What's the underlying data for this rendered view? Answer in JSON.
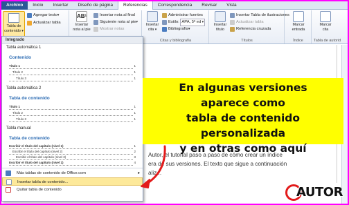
{
  "tabs": [
    "Archivo",
    "Inicio",
    "Insertar",
    "Diseño de página",
    "Referencias",
    "Correspondencia",
    "Revisar",
    "Vista"
  ],
  "ribbon": {
    "toc_button": "Tabla de contenido",
    "agregar_texto": "Agregar texto",
    "actualizar_tabla": "Actualizar tabla",
    "insertar_nota_pie": "Insertar nota al pie",
    "insertar_nota_final": "Insertar nota al final",
    "siguiente_nota": "Siguiente nota al pie",
    "mostrar_notas": "Mostrar notas",
    "insertar_cita": "Insertar cita",
    "administrar_fuentes": "Administrar fuentes",
    "estilo_label": "Estilo:",
    "estilo_value": "APA, 5ª ed",
    "bibliografia": "Bibliografía",
    "group_citas": "Citas y bibliografía",
    "insertar_titulo": "Insertar título",
    "insertar_tabla_ilustraciones": "Insertar Tabla de ilustraciones",
    "actualizar_tabla2": "Actualizar tabla",
    "referencia_cruzada": "Referencia cruzada",
    "group_titulos": "Títulos",
    "marcar_entrada": "Marcar entrada",
    "group_indice": "Índice",
    "marcar_cita": "Marcar cita",
    "group_tabla_autoridades": "Tabla de autorid"
  },
  "menu": {
    "header": "Integrado",
    "auto1_title": "Tabla automática 1",
    "auto1_heading": "Contenido",
    "auto2_title": "Tabla automática 2",
    "auto2_heading": "Tabla de contenido",
    "manual_title": "Tabla manual",
    "manual_heading": "Tabla de contenido",
    "levels": [
      {
        "text": "Título 1",
        "num": "1"
      },
      {
        "text": "Título 2",
        "num": "1"
      },
      {
        "text": "Título 3",
        "num": "1"
      }
    ],
    "manual_lines": [
      {
        "text": "Escribir el título del capítulo (nivel 1)",
        "num": "1"
      },
      {
        "text": "Escribir el título del capítulo (nivel 2)",
        "num": "2"
      },
      {
        "text": "Escribir el título del capítulo (nivel 3)",
        "num": "3"
      },
      {
        "text": "Escribir el título del capítulo (nivel 1)",
        "num": "4"
      }
    ],
    "more_office": "Más tablas de contenido de Office.com",
    "insert_custom": "Insertar tabla de contenido...",
    "remove": "Quitar tabla de contenido"
  },
  "document": {
    "line1": "Autor, el tutorial paso a paso de cómo crear un índice",
    "line2": "era de sus versiones. El texto que sigue a continuación",
    "line3": "aliz..."
  },
  "callout": {
    "line1": "En algunas versiones",
    "line2": "aparece como",
    "line3": "tabla de contenido personalizada",
    "line4": "y en otras como aquí"
  },
  "logo": {
    "text": "AUTOR"
  },
  "colors": {
    "accent": "#2b5797",
    "highlight": "#fde99a",
    "callout": "#ffff00",
    "border": "#ff00ff",
    "arrow": "#e31b1b"
  }
}
